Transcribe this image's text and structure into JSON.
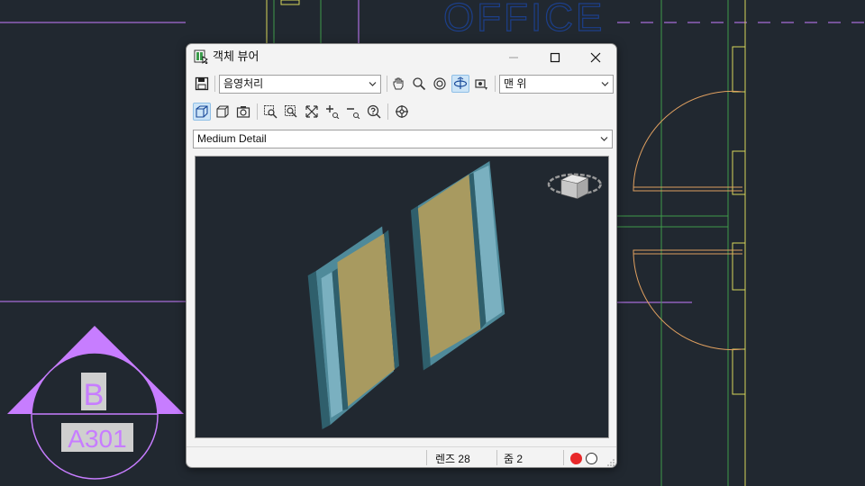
{
  "background": {
    "text_office": "OFFICE",
    "marker_letter": "B",
    "marker_sheet": "A301",
    "colors": {
      "bg": "#212830",
      "magenta": "#c77dff",
      "orange": "#e0a060",
      "yellow": "#d6d65a",
      "green": "#3f9a4a",
      "blue": "#1c3f8a"
    }
  },
  "window": {
    "title": "객체 뷰어",
    "controls": [
      "minimize-icon",
      "maximize-icon",
      "close-icon"
    ]
  },
  "toolbar1": {
    "save_icon": "save-icon",
    "visual_style": "음영처리",
    "tools": [
      "pan-icon",
      "zoom-icon",
      "orbit-icon",
      "free-orbit-icon",
      "capture-icon"
    ],
    "active_tool": "free-orbit-icon",
    "view": "맨 위"
  },
  "toolbar2": {
    "tools": [
      "perspective-icon",
      "parallel-icon",
      "camera-icon",
      "zoom-window-icon",
      "zoom-center-icon",
      "zoom-extents-icon",
      "zoom-in-icon",
      "zoom-out-icon",
      "help-icon",
      "steering-wheel-icon"
    ],
    "active_tool": "perspective-icon"
  },
  "detail_level": {
    "selected": "Medium Detail"
  },
  "viewport": {
    "navigation_cube": "viewcube-icon",
    "colors": {
      "frame": "#4f8a9a",
      "frame_dark": "#2f5f6c",
      "glass": "#7ab0c0",
      "panel": "#a89a60",
      "panel_dark": "#8f8048"
    }
  },
  "status": {
    "lens": "렌즈 28",
    "zoom": "줌 2",
    "indicators": [
      {
        "name": "record-indicator",
        "color": "#e8282a"
      },
      {
        "name": "idle-indicator",
        "color": "#ffffff"
      }
    ]
  }
}
